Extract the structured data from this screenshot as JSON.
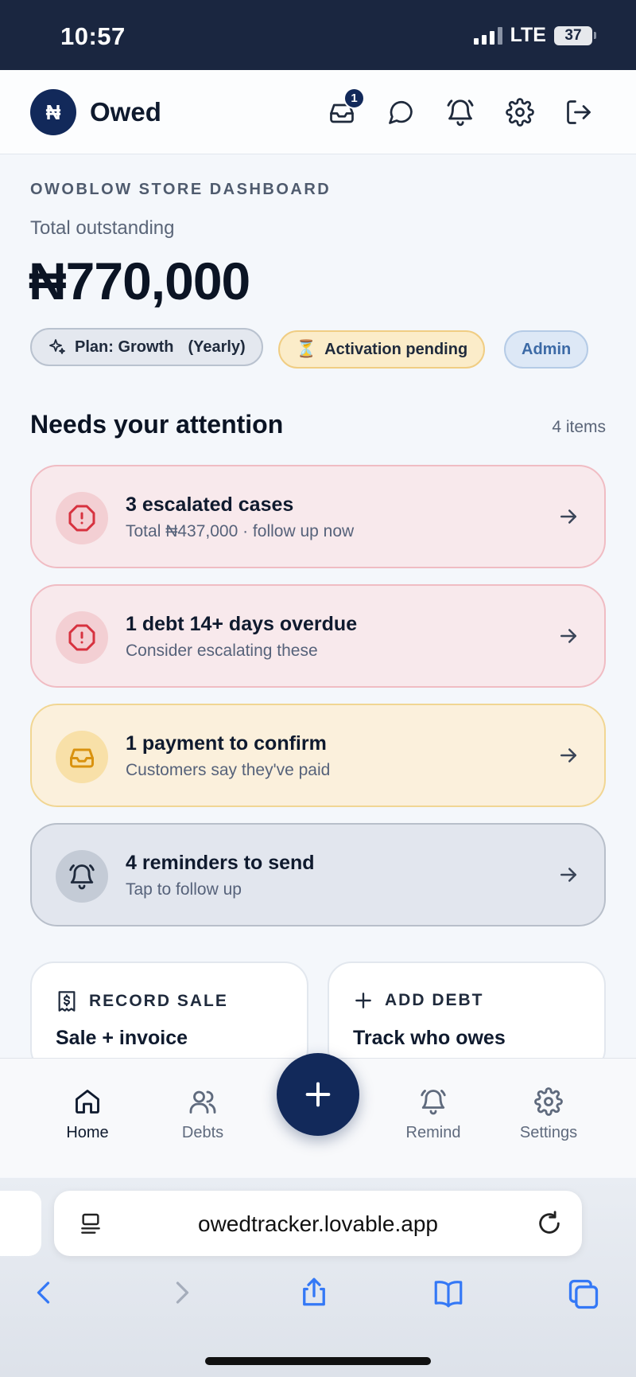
{
  "status": {
    "time": "10:57",
    "network": "LTE",
    "battery": "37"
  },
  "header": {
    "logo_glyph": "₦",
    "brand": "Owed",
    "inbox_badge": "1"
  },
  "dashboard": {
    "label": "OWOBLOW STORE DASHBOARD",
    "total_label": "Total outstanding",
    "total_amount": "₦770,000",
    "chips": {
      "plan": "Plan: Growth",
      "plan_period": "(Yearly)",
      "activation": "Activation pending",
      "role": "Admin"
    }
  },
  "attention": {
    "title": "Needs your attention",
    "count": "4 items",
    "items": [
      {
        "title": "3 escalated cases",
        "subtitle": "Total ₦437,000 · follow up now"
      },
      {
        "title": "1 debt 14+ days overdue",
        "subtitle": "Consider escalating these"
      },
      {
        "title": "1 payment to confirm",
        "subtitle": "Customers say they've paid"
      },
      {
        "title": "4 reminders to send",
        "subtitle": "Tap to follow up"
      }
    ]
  },
  "quick": [
    {
      "heading": "RECORD SALE",
      "title": "Sale + invoice"
    },
    {
      "heading": "ADD DEBT",
      "title": "Track who owes"
    }
  ],
  "nav": {
    "home": "Home",
    "debts": "Debts",
    "remind": "Remind",
    "settings": "Settings"
  },
  "browser": {
    "url": "owedtracker.lovable.app"
  },
  "colors": {
    "primary": "#12295a",
    "danger": "#d7323f",
    "warning": "#e3a216",
    "accent": "#3478f6"
  }
}
